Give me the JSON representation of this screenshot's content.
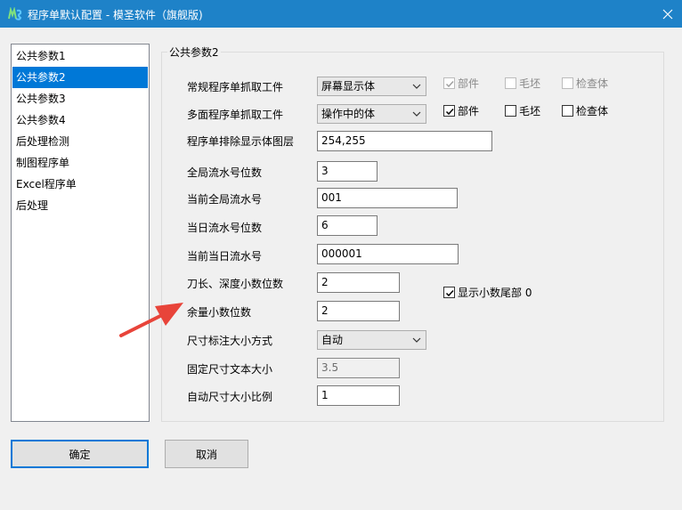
{
  "window": {
    "title": "程序单默认配置 - 模圣软件（旗舰版)",
    "icon": "app-icon",
    "close_icon": "close-icon"
  },
  "sidebar": {
    "items": [
      {
        "label": "公共参数1",
        "selected": false
      },
      {
        "label": "公共参数2",
        "selected": true
      },
      {
        "label": "公共参数3",
        "selected": false
      },
      {
        "label": "公共参数4",
        "selected": false
      },
      {
        "label": "后处理检测",
        "selected": false
      },
      {
        "label": "制图程序单",
        "selected": false
      },
      {
        "label": "Excel程序单",
        "selected": false
      },
      {
        "label": "后处理",
        "selected": false
      }
    ]
  },
  "panel": {
    "group_title": "公共参数2",
    "regular_grab": {
      "label": "常规程序单抓取工件",
      "value": "屏幕显示体"
    },
    "multi_grab": {
      "label": "多面程序单抓取工件",
      "value": "操作中的体"
    },
    "regular_checks": [
      {
        "label": "部件",
        "checked": true,
        "disabled": true
      },
      {
        "label": "毛坯",
        "checked": false,
        "disabled": true
      },
      {
        "label": "检查体",
        "checked": false,
        "disabled": true
      }
    ],
    "multi_checks": [
      {
        "label": "部件",
        "checked": true,
        "disabled": false
      },
      {
        "label": "毛坯",
        "checked": false,
        "disabled": false
      },
      {
        "label": "检查体",
        "checked": false,
        "disabled": false
      }
    ],
    "exclude_layers": {
      "label": "程序单排除显示体图层",
      "value": "254,255"
    },
    "global_serial_digits": {
      "label": "全局流水号位数",
      "value": "3"
    },
    "current_global_serial": {
      "label": "当前全局流水号",
      "value": "001"
    },
    "daily_serial_digits": {
      "label": "当日流水号位数",
      "value": "6"
    },
    "current_daily_serial": {
      "label": "当前当日流水号",
      "value": "000001"
    },
    "tool_decimal": {
      "label": "刀长、深度小数位数",
      "value": "2"
    },
    "show_trailing_zero": {
      "label": "显示小数尾部 0",
      "checked": true
    },
    "stock_decimal": {
      "label": "余量小数位数",
      "value": "2"
    },
    "dim_size_mode": {
      "label": "尺寸标注大小方式",
      "value": "自动"
    },
    "fixed_text_size": {
      "label": "固定尺寸文本大小",
      "value": "3.5"
    },
    "auto_size_ratio": {
      "label": "自动尺寸大小比例",
      "value": "1"
    }
  },
  "buttons": {
    "ok": "确定",
    "cancel": "取消"
  },
  "annotation": {
    "color": "#e8443a"
  }
}
